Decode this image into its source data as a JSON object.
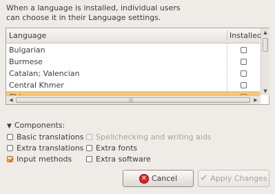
{
  "intro": {
    "line1": "When a language is installed, individual users",
    "line2": "can choose it in their Language settings."
  },
  "list": {
    "header_language": "Language",
    "header_installed": "Installed",
    "rows": [
      {
        "label": "Bulgarian",
        "installed": false,
        "selected": false
      },
      {
        "label": "Burmese",
        "installed": false,
        "selected": false
      },
      {
        "label": "Catalan; Valencian",
        "installed": false,
        "selected": false
      },
      {
        "label": "Central Khmer",
        "installed": false,
        "selected": false
      },
      {
        "label": "Chinese",
        "installed": false,
        "selected": true
      }
    ],
    "scroll_up_icon": "arrow-up-icon",
    "scroll_down_icon": "arrow-down-icon",
    "scroll_left_icon": "arrow-left-icon",
    "scroll_right_icon": "arrow-right-icon",
    "h_grip": "|||"
  },
  "components": {
    "label": "Components:",
    "expander_icon": "expander-down-icon",
    "options": {
      "basic_translations": {
        "label": "Basic translations",
        "checked": false,
        "enabled": true
      },
      "spellchecking": {
        "label": "Spellchecking and writing aids",
        "checked": false,
        "enabled": false
      },
      "extra_translations": {
        "label": "Extra translations",
        "checked": false,
        "enabled": true
      },
      "extra_fonts": {
        "label": "Extra fonts",
        "checked": false,
        "enabled": true
      },
      "input_methods": {
        "label": "Input methods",
        "checked": true,
        "enabled": true
      },
      "extra_software": {
        "label": "Extra software",
        "checked": false,
        "enabled": true
      }
    }
  },
  "buttons": {
    "cancel_label": "Cancel",
    "cancel_icon": "cancel-icon",
    "apply_label": "Apply Changes",
    "apply_icon": "checkmark-icon",
    "apply_enabled": false
  },
  "colors": {
    "selection": "#f5c47b",
    "cancel_icon": "#d92323",
    "window_bg": "#efebe7"
  }
}
